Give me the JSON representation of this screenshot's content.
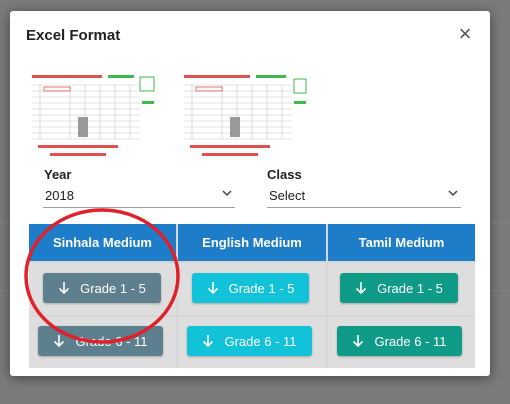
{
  "dialog": {
    "title": "Excel Format",
    "close_icon": "close-icon"
  },
  "filters": {
    "year": {
      "label": "Year",
      "value": "2018"
    },
    "class": {
      "label": "Class",
      "value": "Select"
    }
  },
  "table": {
    "columns": [
      {
        "label": "Sinhala Medium",
        "button_color": "#5e7f8e"
      },
      {
        "label": "English Medium",
        "button_color": "#12c2d8"
      },
      {
        "label": "Tamil Medium",
        "button_color": "#0f9b88"
      }
    ],
    "header_color": "#1e7dc8",
    "rows": [
      {
        "buttons": [
          "Grade 1 - 5",
          "Grade 1 - 5",
          "Grade 1 - 5"
        ]
      },
      {
        "buttons": [
          "Grade 6 - 11",
          "Grade 6 - 11",
          "Grade 6 - 11"
        ]
      }
    ]
  },
  "annotation": {
    "highlight_color": "#e0202a"
  },
  "icons": {
    "download": "arrow-down-icon",
    "dropdown": "chevron-down-icon"
  }
}
